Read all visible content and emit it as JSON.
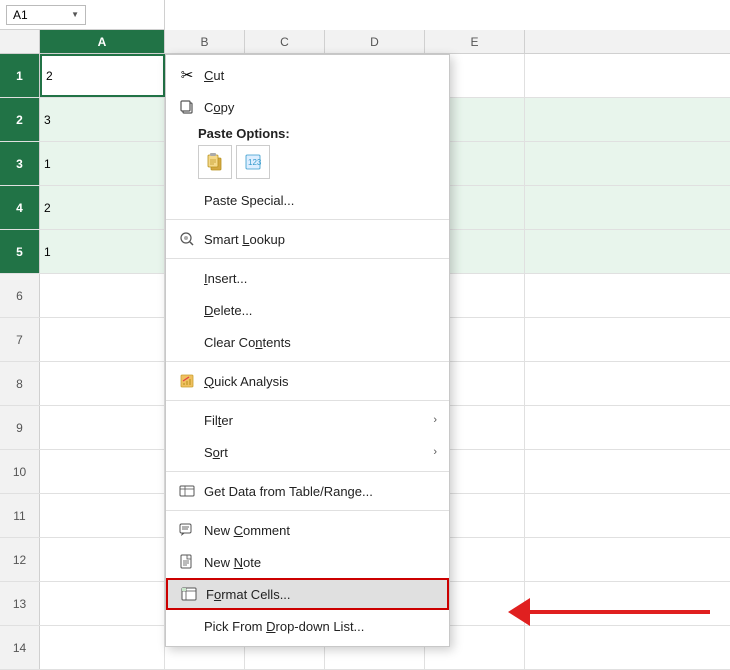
{
  "namebox": {
    "value": "A1",
    "chevron": "▼"
  },
  "columns": [
    "A",
    "B",
    "C",
    "D",
    "E"
  ],
  "rows": [
    {
      "num": 1,
      "a": "2",
      "b": "",
      "c": "",
      "d": "",
      "e": ""
    },
    {
      "num": 2,
      "a": "3",
      "b": "",
      "c": "",
      "d": "",
      "e": ""
    },
    {
      "num": 3,
      "a": "1",
      "b": "",
      "c": "",
      "d": "",
      "e": ""
    },
    {
      "num": 4,
      "a": "2",
      "b": "",
      "c": "",
      "d": "",
      "e": ""
    },
    {
      "num": 5,
      "a": "1",
      "b": "",
      "c": "",
      "d": "",
      "e": ""
    },
    {
      "num": 6,
      "a": "",
      "b": "",
      "c": "",
      "d": "",
      "e": ""
    },
    {
      "num": 7,
      "a": "",
      "b": "",
      "c": "",
      "d": "",
      "e": ""
    },
    {
      "num": 8,
      "a": "",
      "b": "",
      "c": "",
      "d": "",
      "e": ""
    },
    {
      "num": 9,
      "a": "",
      "b": "",
      "c": "",
      "d": "",
      "e": ""
    },
    {
      "num": 10,
      "a": "",
      "b": "",
      "c": "",
      "d": "",
      "e": ""
    },
    {
      "num": 11,
      "a": "",
      "b": "",
      "c": "",
      "d": "",
      "e": ""
    },
    {
      "num": 12,
      "a": "",
      "b": "",
      "c": "",
      "d": "",
      "e": ""
    },
    {
      "num": 13,
      "a": "",
      "b": "",
      "c": "",
      "d": "",
      "e": ""
    },
    {
      "num": 14,
      "a": "",
      "b": "",
      "c": "",
      "d": "",
      "e": ""
    }
  ],
  "menu": {
    "items": [
      {
        "id": "cut",
        "label": "Cut",
        "icon": "✂",
        "has_arrow": false
      },
      {
        "id": "copy",
        "label": "Copy",
        "icon": "copy",
        "has_arrow": false
      },
      {
        "id": "paste-options-label",
        "label": "Paste Options:",
        "icon": "",
        "is_section": true
      },
      {
        "id": "insert",
        "label": "Insert...",
        "icon": "",
        "has_arrow": false
      },
      {
        "id": "delete",
        "label": "Delete...",
        "icon": "",
        "has_arrow": false
      },
      {
        "id": "clear-contents",
        "label": "Clear Contents",
        "icon": "",
        "has_arrow": false
      },
      {
        "id": "quick-analysis",
        "label": "Quick Analysis",
        "icon": "quick",
        "has_arrow": false
      },
      {
        "id": "filter",
        "label": "Filter",
        "icon": "",
        "has_arrow": true
      },
      {
        "id": "sort",
        "label": "Sort",
        "icon": "",
        "has_arrow": true
      },
      {
        "id": "get-data",
        "label": "Get Data from Table/Range...",
        "icon": "table",
        "has_arrow": false
      },
      {
        "id": "new-comment",
        "label": "New Comment",
        "icon": "comment",
        "has_arrow": false
      },
      {
        "id": "new-note",
        "label": "New Note",
        "icon": "note",
        "has_arrow": false
      },
      {
        "id": "format-cells",
        "label": "Format Cells...",
        "icon": "fmtcells",
        "has_arrow": false,
        "highlighted": true
      },
      {
        "id": "pick-dropdown",
        "label": "Pick From Drop-down List...",
        "icon": "",
        "has_arrow": false
      }
    ],
    "smart_lookup_label": "Smart Lookup",
    "paste_special_label": "Paste Special..."
  }
}
